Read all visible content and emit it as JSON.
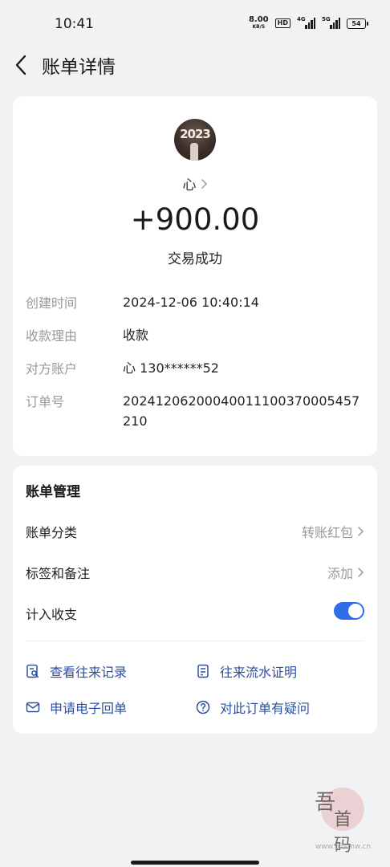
{
  "status_bar": {
    "time": "10:41",
    "net_speed": "8.00",
    "net_unit": "KB/S",
    "hd": "HD",
    "signal1_label": "4G",
    "signal2_label": "5G",
    "battery": "54"
  },
  "header": {
    "title": "账单详情",
    "back_icon": "chevron-left-icon"
  },
  "payee": {
    "avatar_text": "2023",
    "name": "心"
  },
  "transaction": {
    "amount": "+900.00",
    "status": "交易成功"
  },
  "details": [
    {
      "label": "创建时间",
      "value": "2024-12-06 10:40:14"
    },
    {
      "label": "收款理由",
      "value": "收款"
    },
    {
      "label": "对方账户",
      "value": "心 130******52"
    },
    {
      "label": "订单号",
      "value": "20241206200040011100370005457210"
    }
  ],
  "management": {
    "title": "账单管理",
    "category_label": "账单分类",
    "category_value": "转账红包",
    "tags_label": "标签和备注",
    "tags_action": "添加",
    "include_label": "计入收支",
    "include_enabled": true,
    "accent_color": "#2f6ee8",
    "links": [
      {
        "label": "查看往来记录",
        "icon": "record-search-icon"
      },
      {
        "label": "往来流水证明",
        "icon": "statement-icon"
      },
      {
        "label": "申请电子回单",
        "icon": "mail-icon"
      },
      {
        "label": "对此订单有疑问",
        "icon": "question-icon"
      }
    ]
  },
  "watermark": {
    "glyph1": "吾",
    "glyph2": "首码",
    "site": "www.52smw.cn"
  }
}
